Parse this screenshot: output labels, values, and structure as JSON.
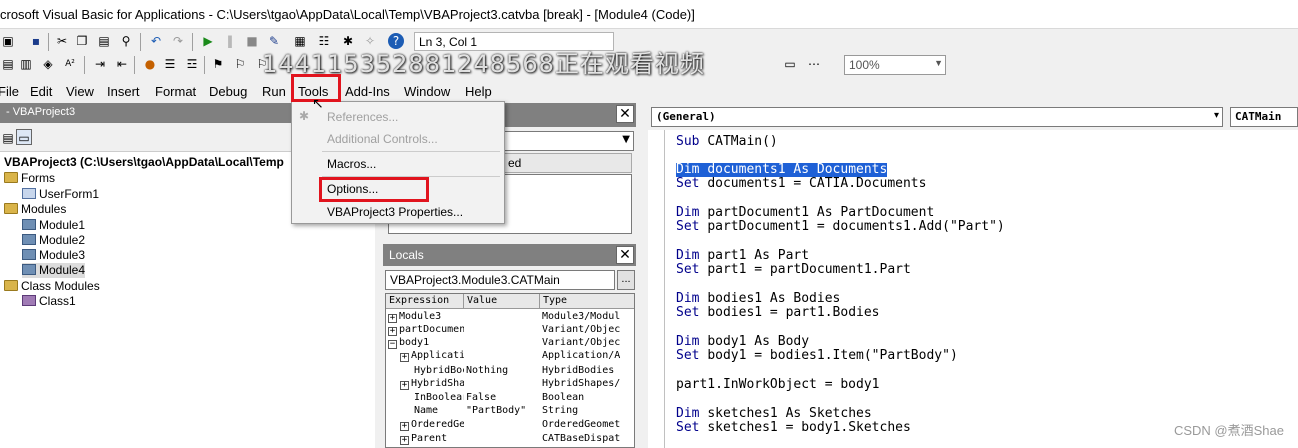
{
  "window": {
    "title": "crosoft Visual Basic for Applications - C:\\Users\\tgao\\AppData\\Local\\Temp\\VBAProject3.catvba [break] - [Module4 (Code)]"
  },
  "toolbar": {
    "position_text": "Ln 3, Col 1",
    "zoom": "100%"
  },
  "overlay_text": "144115352881248568正在观看视频",
  "menu": [
    "File",
    "Edit",
    "View",
    "Insert",
    "Format",
    "Debug",
    "Run",
    "Tools",
    "Add-Ins",
    "Window",
    "Help"
  ],
  "tools_menu": {
    "references": "References...",
    "additional_controls": "Additional Controls...",
    "macros": "Macros...",
    "options": "Options...",
    "project_properties": "VBAProject3 Properties..."
  },
  "project": {
    "header": "- VBAProject3",
    "root": "VBAProject3 (C:\\Users\\tgao\\AppData\\Local\\Temp",
    "forms_folder": "Forms",
    "form1": "UserForm1",
    "modules_folder": "Modules",
    "modules": [
      "Module1",
      "Module2",
      "Module3",
      "Module4"
    ],
    "class_modules_folder": "Class Modules",
    "class1": "Class1"
  },
  "properties": {
    "tab_label": "ed"
  },
  "locals": {
    "title": "Locals",
    "path": "VBAProject3.Module3.CATMain",
    "ellipsis": "...",
    "columns": [
      "Expression",
      "Value",
      "Type"
    ],
    "rows": [
      {
        "expr": "Module3",
        "value": "",
        "type": "Module3/Modul"
      },
      {
        "expr": "partDocumen",
        "value": "",
        "type": "Variant/Objec"
      },
      {
        "expr": "body1",
        "value": "",
        "type": "Variant/Objec"
      },
      {
        "expr": "Applicati",
        "value": "",
        "type": "Application/A"
      },
      {
        "expr": "HybridBoc",
        "value": "Nothing",
        "type": "HybridBodies"
      },
      {
        "expr": "HybridSha",
        "value": "",
        "type": "HybridShapes/"
      },
      {
        "expr": "InBoolear",
        "value": "False",
        "type": "Boolean"
      },
      {
        "expr": "Name",
        "value": "\"PartBody\"",
        "type": "String"
      },
      {
        "expr": "OrderedGe",
        "value": "",
        "type": "OrderedGeomet"
      },
      {
        "expr": "Parent",
        "value": "",
        "type": "CATBaseDispat"
      }
    ]
  },
  "code": {
    "object_combo": "(General)",
    "proc_combo": "CATMain",
    "lines": [
      {
        "kw": "Sub ",
        "rest": "CATMain()"
      },
      {
        "kw": "Dim ",
        "rest": "documents1 As Documents"
      },
      {
        "kw": "Set ",
        "rest": "documents1 = CATIA.Documents"
      },
      {
        "kw": "Dim ",
        "rest": "partDocument1 As PartDocument"
      },
      {
        "kw": "Set ",
        "rest": "partDocument1 = documents1.Add(\"Part\")"
      },
      {
        "kw": "Dim ",
        "rest": "part1 As Part"
      },
      {
        "kw": "Set ",
        "rest": "part1 = partDocument1.Part"
      },
      {
        "kw": "Dim ",
        "rest": "bodies1 As Bodies"
      },
      {
        "kw": "Set ",
        "rest": "bodies1 = part1.Bodies"
      },
      {
        "kw": "Dim ",
        "rest": "body1 As Body"
      },
      {
        "kw": "Set ",
        "rest": "body1 = bodies1.Item(\"PartBody\")"
      },
      {
        "kw": "",
        "rest": "part1.InWorkObject = body1"
      },
      {
        "kw": "Dim ",
        "rest": "sketches1 As Sketches"
      },
      {
        "kw": "Set ",
        "rest": "sketches1 = body1.Sketches"
      }
    ]
  },
  "watermark": "CSDN @煮酒Shae"
}
